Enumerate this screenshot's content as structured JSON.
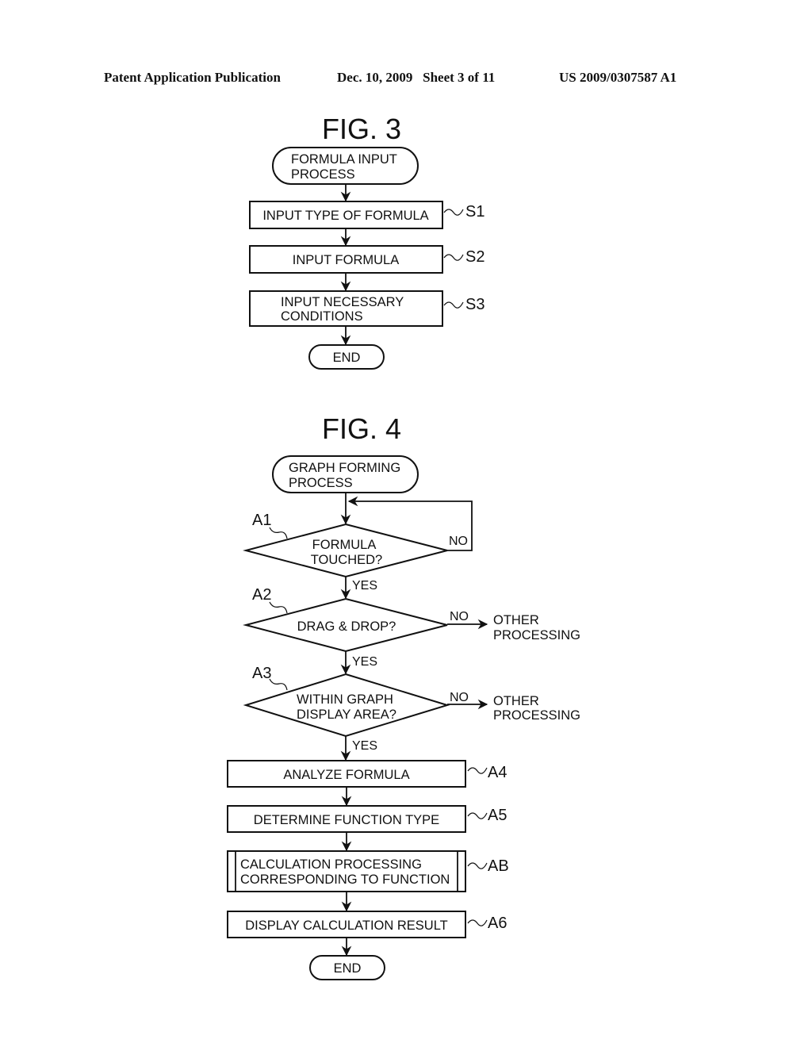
{
  "header": {
    "left": "Patent Application Publication",
    "center": "Dec. 10, 2009   Sheet 3 of 11",
    "right": "US 2009/0307587 A1"
  },
  "fig3": {
    "title": "FIG. 3",
    "start": [
      "FORMULA INPUT",
      "PROCESS"
    ],
    "steps": [
      {
        "ref": "S1",
        "lines": [
          "INPUT TYPE OF FORMULA"
        ]
      },
      {
        "ref": "S2",
        "lines": [
          "INPUT FORMULA"
        ]
      },
      {
        "ref": "S3",
        "lines": [
          "INPUT NECESSARY",
          "CONDITIONS"
        ]
      }
    ],
    "end": "END"
  },
  "fig4": {
    "title": "FIG. 4",
    "start": [
      "GRAPH FORMING",
      "PROCESS"
    ],
    "decisions": [
      {
        "ref": "A1",
        "lines": [
          "FORMULA",
          "TOUCHED?"
        ],
        "no": "NO",
        "yes": "YES"
      },
      {
        "ref": "A2",
        "lines": [
          "DRAG & DROP?"
        ],
        "no": "NO",
        "yes": "YES",
        "no_target": [
          "OTHER",
          "PROCESSING"
        ]
      },
      {
        "ref": "A3",
        "lines": [
          "WITHIN GRAPH",
          "DISPLAY AREA?"
        ],
        "no": "NO",
        "yes": "YES",
        "no_target": [
          "OTHER",
          "PROCESSING"
        ]
      }
    ],
    "steps": [
      {
        "ref": "A4",
        "lines": [
          "ANALYZE FORMULA"
        ]
      },
      {
        "ref": "A5",
        "lines": [
          "DETERMINE FUNCTION TYPE"
        ]
      },
      {
        "ref": "AB",
        "lines": [
          "CALCULATION PROCESSING",
          "CORRESPONDING TO FUNCTION"
        ],
        "subroutine": true
      },
      {
        "ref": "A6",
        "lines": [
          "DISPLAY CALCULATION RESULT"
        ]
      }
    ],
    "end": "END"
  }
}
